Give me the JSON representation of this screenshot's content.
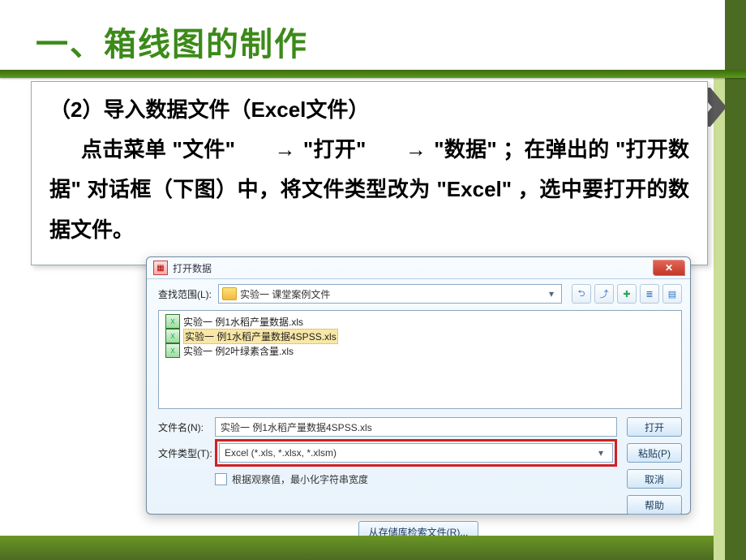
{
  "slide": {
    "title": "一、箱线图的制作",
    "subtitle": "（2）导入数据文件（Excel文件）",
    "body_parts": {
      "prefix": "点击菜单",
      "q1": "\"文件\"",
      "arrow": "→",
      "q2": "\"打开\"",
      "q3": "\"数据\"",
      "mid1": "；在弹出的",
      "q4": "\"打开数据\"",
      "mid2": "对话框（下图）中，将文件类型改为",
      "q5": "\"Excel\"",
      "tail": "，选中要打开的数据文件。"
    }
  },
  "dialog": {
    "title": "打开数据",
    "lookin_label": "查找范围(L):",
    "lookin_value": "实验一 课堂案例文件",
    "files": [
      {
        "name": "实验一 例1水稻产量数据.xls",
        "selected": false
      },
      {
        "name": "实验一 例1水稻产量数据4SPSS.xls",
        "selected": true
      },
      {
        "name": "实验一 例2叶绿素含量.xls",
        "selected": false
      }
    ],
    "filename_label": "文件名(N):",
    "filename_value": "实验一 例1水稻产量数据4SPSS.xls",
    "filetype_label": "文件类型(T):",
    "filetype_value": "Excel (*.xls, *.xlsx, *.xlsm)",
    "minimize_checkbox": "根据观察值，最小化字符串宽度",
    "buttons": {
      "open": "打开",
      "paste": "粘贴(P)",
      "cancel": "取消",
      "help": "帮助"
    },
    "retrieve": "从存储库检索文件(R)..."
  },
  "icons": {
    "app": "▦",
    "xls": "X",
    "back": "⮌",
    "up": "⤴",
    "new": "✚",
    "list": "≣",
    "detail": "▤",
    "dropdown": "▾",
    "close": "✕"
  }
}
